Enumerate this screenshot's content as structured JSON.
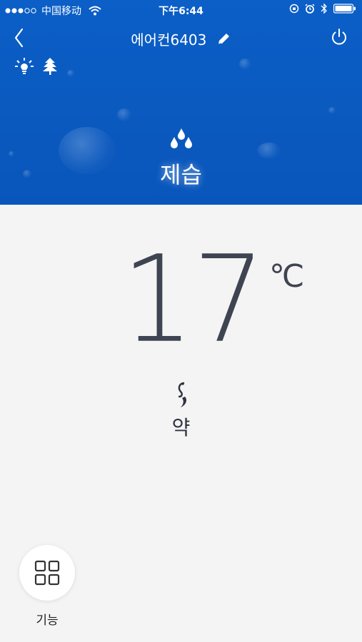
{
  "status_bar": {
    "carrier": "中国移动",
    "time": "下午6:44"
  },
  "nav": {
    "title": "에어컨6403",
    "icons": [
      "back-icon",
      "edit-icon",
      "power-icon"
    ]
  },
  "status_icons": [
    "light-icon",
    "tree-icon"
  ],
  "mode": {
    "label": "제습",
    "icon": "droplets-icon"
  },
  "temperature": {
    "value": "17",
    "unit": "℃"
  },
  "fan": {
    "label": "약",
    "icon": "fan-icon"
  },
  "function_button": {
    "label": "기능",
    "icon": "grid-icon"
  },
  "colors": {
    "header_blue": "#0b5fc7",
    "body_bg": "#f4f4f4",
    "temp_text": "#3f4452"
  }
}
